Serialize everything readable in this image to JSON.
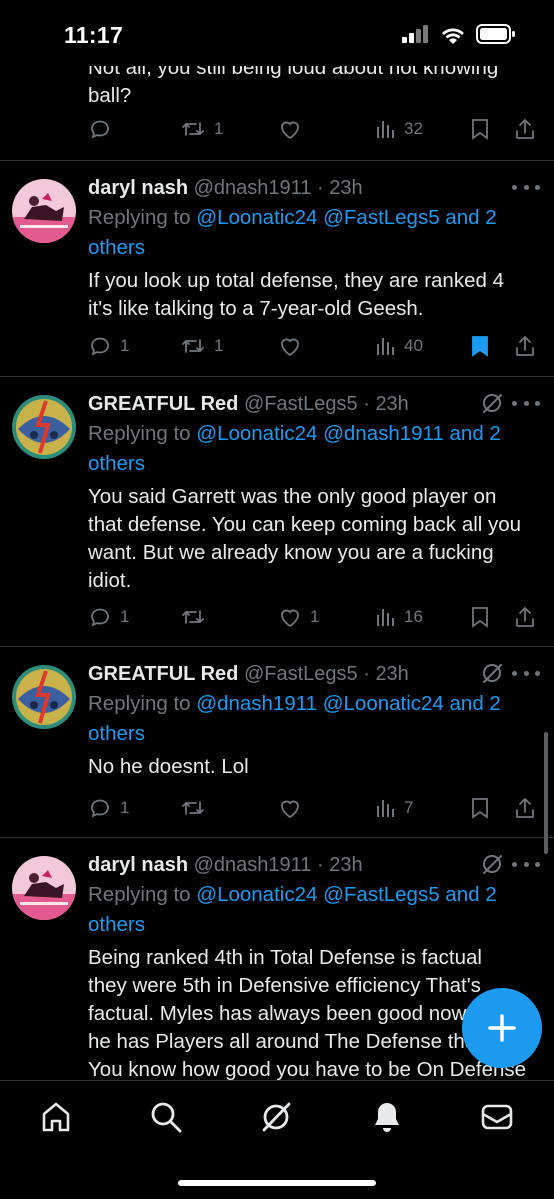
{
  "status_bar": {
    "time": "11:17"
  },
  "top_partial": {
    "text_line1": "Not all, you still being loud about not knowing",
    "text_line2": "ball?",
    "retweets": "1",
    "views": "32"
  },
  "tweets": [
    {
      "name": "daryl nash",
      "handle": "@dnash1911",
      "time": "23h",
      "replying_prefix": "Replying to ",
      "mentions": "@Loonatic24 @FastLegs5 and 2",
      "mentions_cont": "others",
      "lines": [
        "If you look up total defense, they are ranked 4",
        "it's like talking to a 7-year-old Geesh."
      ],
      "replies": "1",
      "retweets": "1",
      "likes": "",
      "views": "40",
      "bookmarked": true
    },
    {
      "name": "GREATFUL Red",
      "handle": "@FastLegs5",
      "time": "23h",
      "replying_prefix": "Replying to ",
      "mentions": "@Loonatic24 @dnash1911 and 2",
      "mentions_cont": "others",
      "lines": [
        "You said Garrett was the only good player on",
        "that defense. You can keep coming back all you",
        "want. But we already know you are a fucking",
        "idiot."
      ],
      "replies": "1",
      "retweets": "",
      "likes": "1",
      "views": "16",
      "bookmarked": false
    },
    {
      "name": "GREATFUL Red",
      "handle": "@FastLegs5",
      "time": "23h",
      "replying_prefix": "Replying to ",
      "mentions": "@dnash1911 @Loonatic24 and 2",
      "mentions_cont": "others",
      "lines": [
        "No he doesnt. Lol"
      ],
      "replies": "1",
      "retweets": "",
      "likes": "",
      "views": "7",
      "bookmarked": false
    },
    {
      "name": "daryl nash",
      "handle": "@dnash1911",
      "time": "23h",
      "replying_prefix": "Replying to ",
      "mentions": "@Loonatic24 @FastLegs5 and 2",
      "mentions_cont": "others",
      "lines": [
        "Being ranked 4th in Total Defense is factual",
        "they were 5th in Defensive efficiency That's",
        "factual. Myles has always been good now",
        "he has Players all around The Defense that",
        "You know how good you have to be On Defense"
      ]
    }
  ],
  "dot_separator": "·",
  "colors": {
    "accent": "#1d9bf0",
    "muted": "#71767b",
    "text": "#e7e9ea",
    "divider": "#2f3336"
  },
  "tab_bar": [
    "home-icon",
    "search-icon",
    "grok-icon",
    "notifications-icon",
    "messages-icon"
  ],
  "fab": "compose-plus-icon"
}
